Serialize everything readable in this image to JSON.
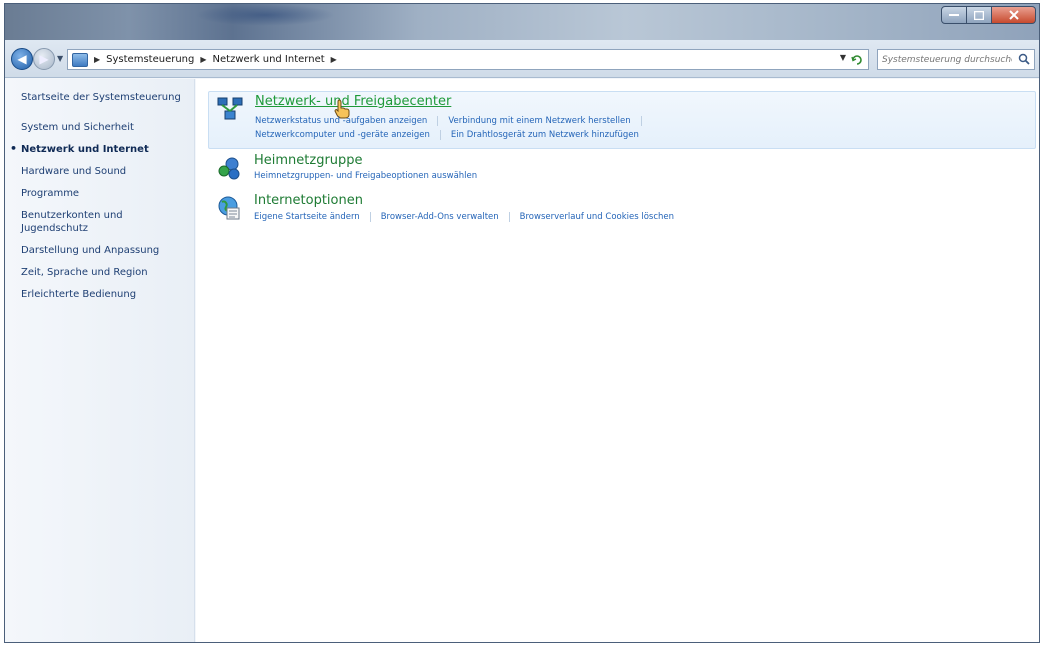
{
  "navbar": {
    "crumbs": [
      "Systemsteuerung",
      "Netzwerk und Internet"
    ],
    "search_placeholder": "Systemsteuerung durchsuchen"
  },
  "sidebar": {
    "items": [
      {
        "label": "Startseite der Systemsteuerung"
      },
      {
        "label": "System und Sicherheit"
      },
      {
        "label": "Netzwerk und Internet",
        "active": true
      },
      {
        "label": "Hardware und Sound"
      },
      {
        "label": "Programme"
      },
      {
        "label": "Benutzerkonten und Jugendschutz"
      },
      {
        "label": "Darstellung und Anpassung"
      },
      {
        "label": "Zeit, Sprache und Region"
      },
      {
        "label": "Erleichterte Bedienung"
      }
    ]
  },
  "main": {
    "categories": [
      {
        "title": "Netzwerk- und Freigabecenter",
        "icon": "network-sharing-icon",
        "links_row1": [
          "Netzwerkstatus und -aufgaben anzeigen",
          "Verbindung mit einem Netzwerk herstellen"
        ],
        "links_row2": [
          "Netzwerkcomputer und -geräte anzeigen",
          "Ein Drahtlosgerät zum Netzwerk hinzufügen"
        ]
      },
      {
        "title": "Heimnetzgruppe",
        "icon": "homegroup-icon",
        "links_row1": [
          "Heimnetzgruppen- und Freigabeoptionen auswählen"
        ]
      },
      {
        "title": "Internetoptionen",
        "icon": "internet-options-icon",
        "links_row1": [
          "Eigene Startseite ändern",
          "Browser-Add-Ons verwalten",
          "Browserverlauf und Cookies löschen"
        ]
      }
    ]
  },
  "colors": {
    "title_green": "#1f9a3a",
    "link_blue": "#2565b8",
    "sidebar_text": "#1e3f73"
  }
}
